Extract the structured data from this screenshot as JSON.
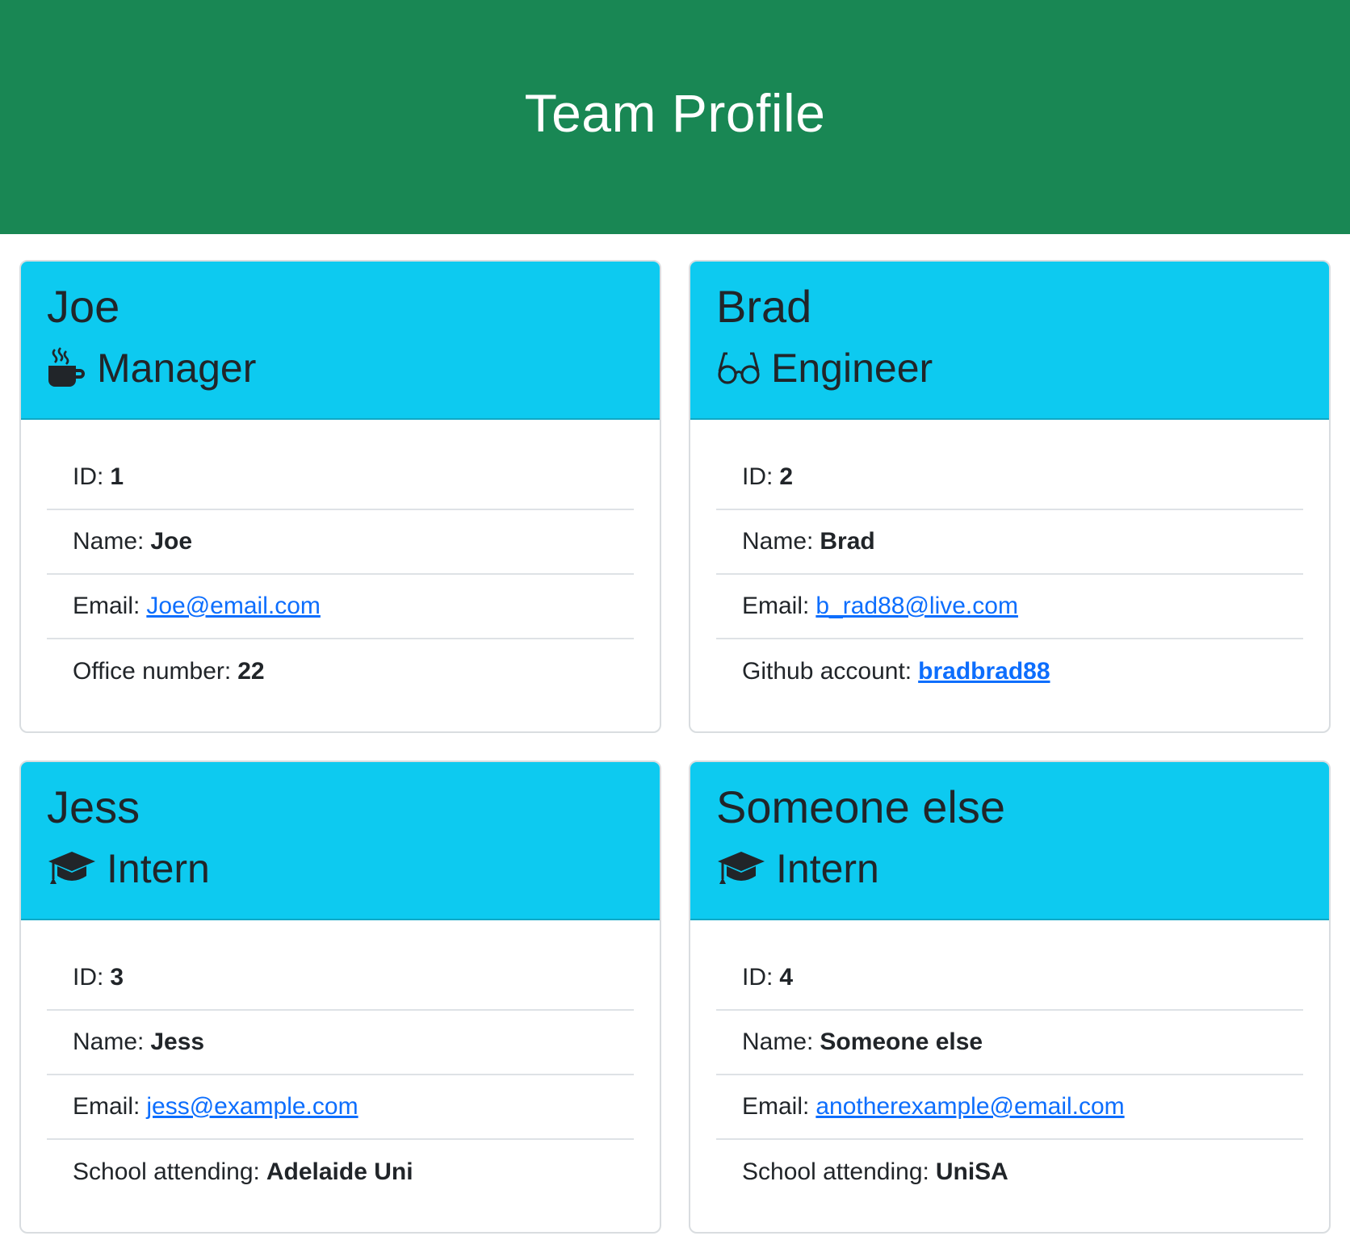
{
  "header": {
    "title": "Team Profile"
  },
  "colors": {
    "header_bg": "#198754",
    "card_header_bg": "#0dcaf0",
    "link": "#0d6efd"
  },
  "cards": [
    {
      "name": "Joe",
      "role": "Manager",
      "icon": "coffee-icon",
      "id_label": "ID:",
      "id_value": "1",
      "name_label": "Name:",
      "name_value": "Joe",
      "email_label": "Email:",
      "email_value": "Joe@email.com",
      "extra_label": "Office number:",
      "extra_value": "22"
    },
    {
      "name": "Brad",
      "role": "Engineer",
      "icon": "glasses-icon",
      "id_label": "ID:",
      "id_value": "2",
      "name_label": "Name:",
      "name_value": "Brad",
      "email_label": "Email:",
      "email_value": "b_rad88@live.com",
      "extra_label": "Github account:",
      "extra_value": "bradbrad88"
    },
    {
      "name": "Jess",
      "role": "Intern",
      "icon": "graduation-cap-icon",
      "id_label": "ID:",
      "id_value": "3",
      "name_label": "Name:",
      "name_value": "Jess",
      "email_label": "Email:",
      "email_value": "jess@example.com",
      "extra_label": "School attending:",
      "extra_value": "Adelaide Uni"
    },
    {
      "name": "Someone else",
      "role": "Intern",
      "icon": "graduation-cap-icon",
      "id_label": "ID:",
      "id_value": "4",
      "name_label": "Name:",
      "name_value": "Someone else",
      "email_label": "Email:",
      "email_value": "anotherexample@email.com",
      "extra_label": "School attending:",
      "extra_value": "UniSA"
    }
  ]
}
